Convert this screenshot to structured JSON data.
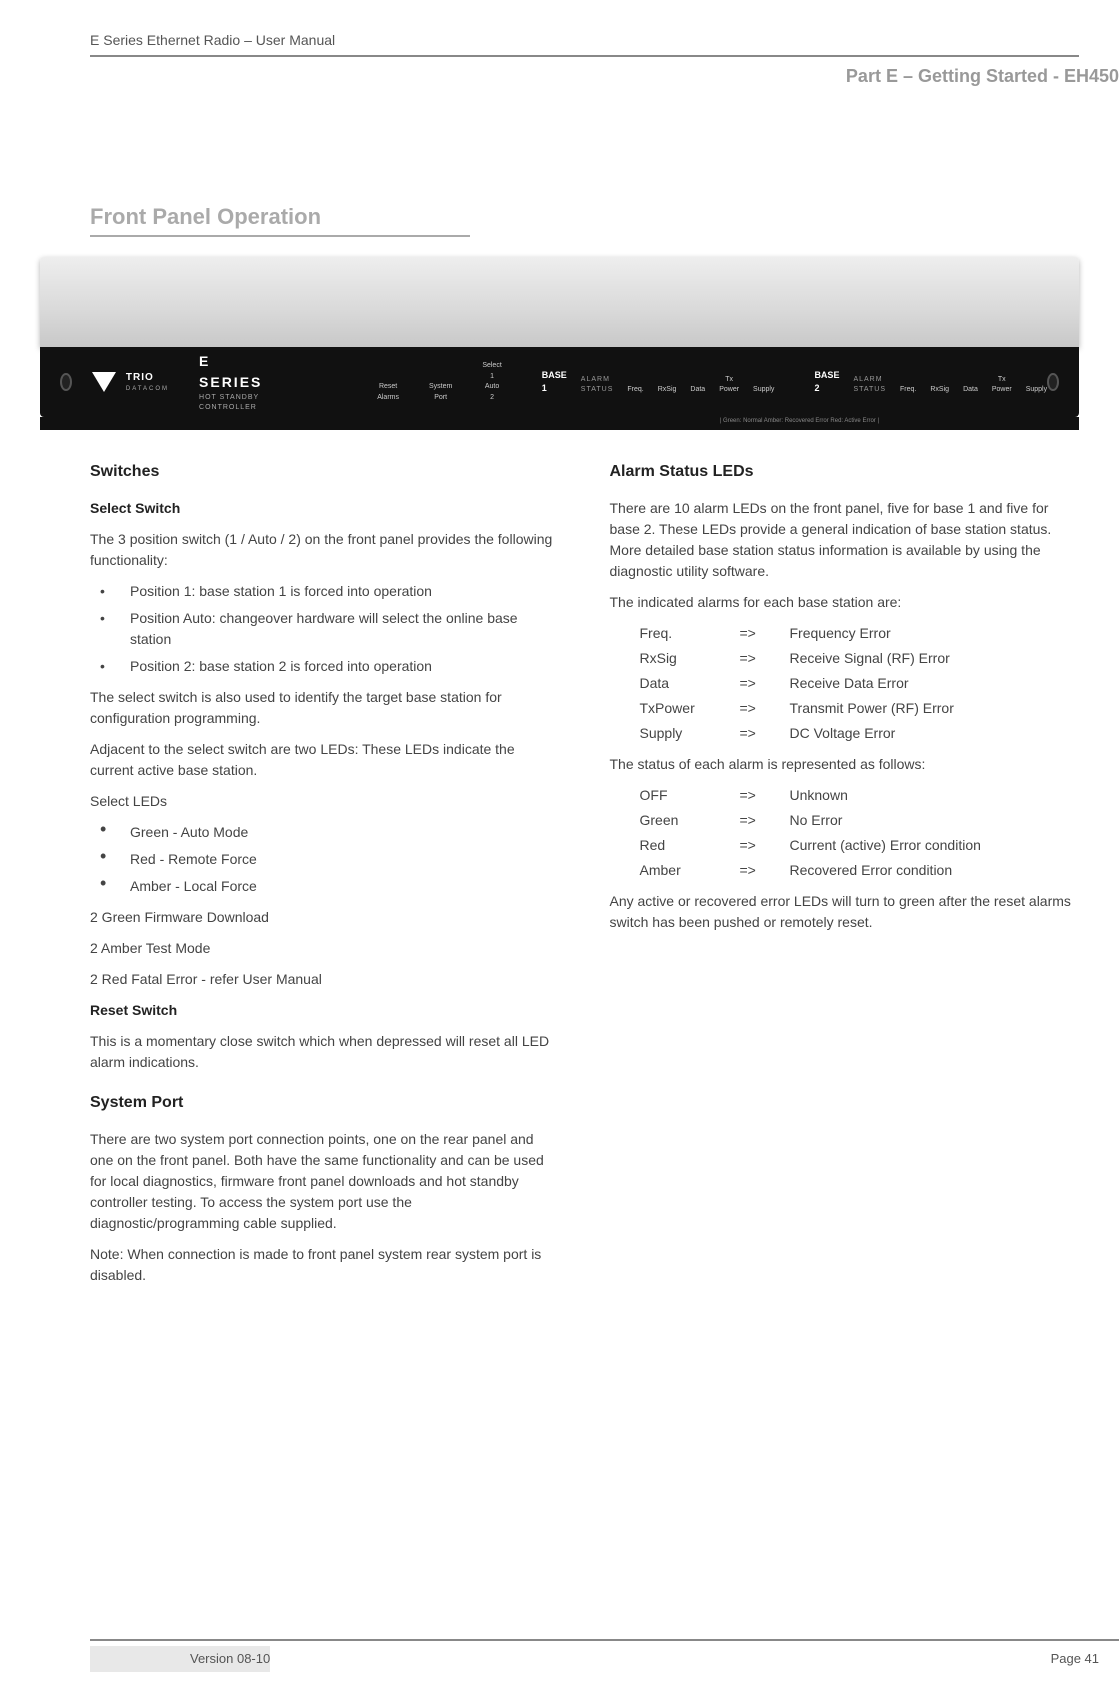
{
  "header": {
    "doc_title": "E Series Ethernet Radio – User Manual",
    "part_label": "Part E –  Getting Started - EH450"
  },
  "section_title": "Front Panel Operation",
  "device": {
    "brand": "TRIO",
    "brand_sub": "DATACOM",
    "series": "E SERIES",
    "series_sub": "HOT STANDBY CONTROLLER",
    "reset_alarms": "Reset Alarms",
    "system_port": "System Port",
    "select": "Select",
    "select_positions": "1   Auto   2",
    "base1": "BASE 1",
    "base2": "BASE 2",
    "alarm_status": "ALARM STATUS",
    "led_labels": [
      "Freq.",
      "RxSig",
      "Data",
      "Tx Power",
      "Supply"
    ],
    "legend": "| Green: Normal          Amber: Recovered Error          Red: Active Error |"
  },
  "left": {
    "switches_title": "Switches",
    "select_switch_title": "Select Switch",
    "select_intro": "The 3 position switch (1 / Auto / 2) on the front panel provides the following functionality:",
    "select_positions": [
      "Position 1: base station 1 is forced into operation",
      "Position Auto: changeover hardware will select the online base station",
      "Position 2: base station 2 is forced into operation"
    ],
    "select_para2": "The select switch is also used to identify the target base station for configuration programming.",
    "select_para3": "Adjacent to the select switch are two LEDs: These LEDs indicate the current active base station.",
    "select_leds_label": "Select LEDs",
    "select_leds": [
      "Green - Auto Mode",
      "Red - Remote Force",
      "Amber - Local Force"
    ],
    "fw_lines": [
      "2 Green Firmware Download",
      "2 Amber Test Mode",
      "2 Red Fatal Error - refer User Manual"
    ],
    "reset_switch_title": "Reset Switch",
    "reset_switch_text": "This is a momentary close switch which when depressed will reset all LED alarm indications.",
    "system_port_title": "System Port",
    "system_port_text": "There are two system port connection points, one on the rear panel and one on the front panel. Both have the same functionality and can be used for local diagnostics, firmware front panel downloads and hot standby controller testing. To access the system port use the diagnostic/programming cable supplied.",
    "system_port_note": "Note: When connection is made to front panel system rear system port is disabled."
  },
  "right": {
    "alarm_title": "Alarm Status LEDs",
    "alarm_intro": "There are 10 alarm LEDs on the front panel, five for base 1 and five for base 2. These LEDs provide a general indication of base station status. More detailed base station status information is available by using the diagnostic utility software.",
    "alarm_list_intro": "The indicated alarms for each base station are:",
    "alarm_map": [
      {
        "k": "Freq.",
        "v": "Frequency Error"
      },
      {
        "k": "RxSig",
        "v": "Receive Signal (RF) Error"
      },
      {
        "k": "Data",
        "v": "Receive Data Error"
      },
      {
        "k": "TxPower",
        "v": "Transmit Power (RF) Error"
      },
      {
        "k": "Supply",
        "v": "DC Voltage Error"
      }
    ],
    "status_intro": "The status of each alarm is represented as follows:",
    "status_map": [
      {
        "k": "OFF",
        "v": "Unknown"
      },
      {
        "k": "Green",
        "v": " No Error"
      },
      {
        "k": "Red",
        "v": "Current (active) Error condition"
      },
      {
        "k": "Amber",
        "v": "Recovered Error condition"
      }
    ],
    "alarm_outro": "Any active or recovered error LEDs will turn to green after the reset alarms switch has been pushed or remotely reset."
  },
  "footer": {
    "version": "Version 08-10",
    "page": "Page 41"
  },
  "arrow": "=>"
}
